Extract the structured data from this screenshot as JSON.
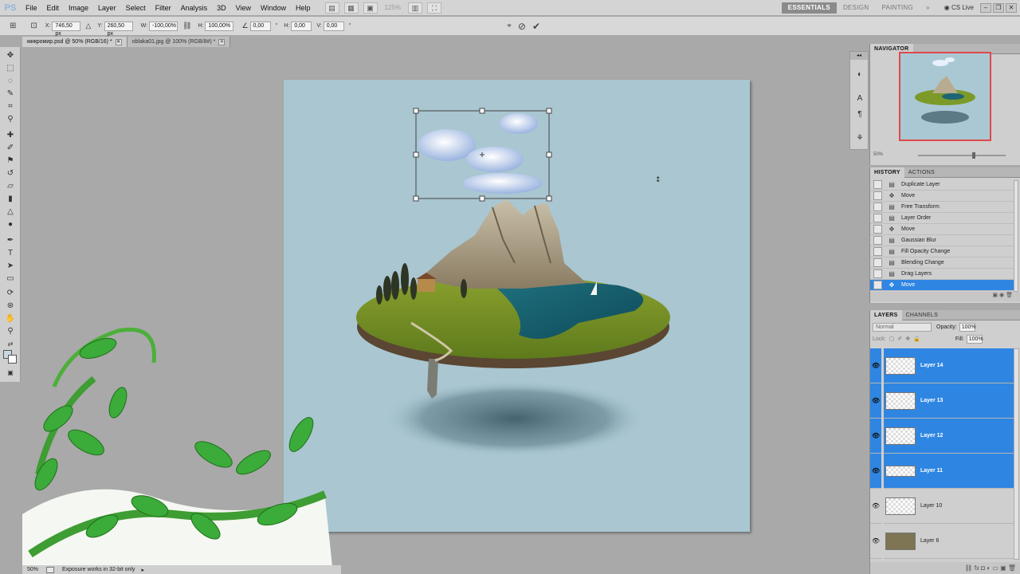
{
  "app": {
    "logo": "PS",
    "menu": [
      "File",
      "Edit",
      "Image",
      "Layer",
      "Select",
      "Filter",
      "Analysis",
      "3D",
      "View",
      "Window",
      "Help"
    ],
    "zoom_display": "125%",
    "workspaces": [
      "ESSENTIALS",
      "DESIGN",
      "PAINTING",
      "»"
    ],
    "cslive": "CS Live",
    "window_controls": [
      "–",
      "❐",
      "✕"
    ]
  },
  "options_bar": {
    "x_label": "X:",
    "x_value": "746,50 px",
    "y_label": "Y:",
    "y_value": "260,50 px",
    "w_label": "W:",
    "w_value": "-100,00%",
    "h_label": "H:",
    "h_value": "100,00%",
    "angle_value": "0,00",
    "h_skew_label": "H:",
    "h_skew_value": "0,00",
    "v_skew_label": "V:",
    "v_skew_value": "0,00"
  },
  "tabs": [
    {
      "label": "микромир.psd @ 50% (RGB/16) *",
      "active": true
    },
    {
      "label": "oblaka01.jpg @ 100% (RGB/8#) *",
      "active": false
    }
  ],
  "status": {
    "zoom": "50%",
    "message": "Exposure works in 32-bit only"
  },
  "navigator": {
    "title": "NAVIGATOR",
    "zoom": "50%"
  },
  "history": {
    "tabs": [
      "HISTORY",
      "ACTIONS"
    ],
    "items": [
      {
        "label": "Duplicate Layer",
        "icon": "doc-icon"
      },
      {
        "label": "Move",
        "icon": "move-icon"
      },
      {
        "label": "Free Transform",
        "icon": "doc-icon"
      },
      {
        "label": "Layer Order",
        "icon": "doc-icon"
      },
      {
        "label": "Move",
        "icon": "move-icon"
      },
      {
        "label": "Gaussian Blur",
        "icon": "doc-icon"
      },
      {
        "label": "Fill Opacity Change",
        "icon": "doc-icon"
      },
      {
        "label": "Blending Change",
        "icon": "doc-icon"
      },
      {
        "label": "Drag Layers",
        "icon": "doc-icon"
      },
      {
        "label": "Move",
        "icon": "move-icon",
        "active": true
      }
    ]
  },
  "layers": {
    "tabs": [
      "LAYERS",
      "CHANNELS"
    ],
    "blend_mode": "Normal",
    "opacity_label": "Opacity:",
    "opacity": "100%",
    "lock_label": "Lock:",
    "fill_label": "Fill:",
    "fill": "100%",
    "items": [
      {
        "name": "Layer 14",
        "selected": true
      },
      {
        "name": "Layer 13",
        "selected": true
      },
      {
        "name": "Layer 12",
        "selected": true
      },
      {
        "name": "Layer 11",
        "selected": true
      },
      {
        "name": "Layer 10",
        "selected": false
      },
      {
        "name": "Layer 6",
        "selected": false
      }
    ]
  },
  "colors": {
    "accent": "#2f86e2",
    "canvas_bg": "#a9c6d1",
    "nav_frame": "#e0484a"
  }
}
